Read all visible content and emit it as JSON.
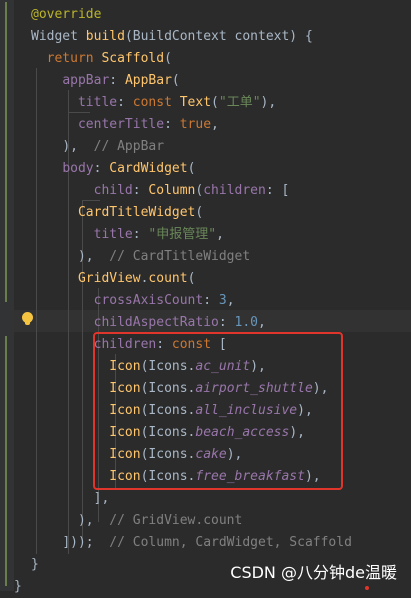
{
  "editor": {
    "lines": [
      {
        "segments": [
          {
            "t": "@override",
            "c": "ann"
          }
        ]
      },
      {
        "segments": [
          {
            "t": "Widget ",
            "c": ""
          },
          {
            "t": "build",
            "c": "fn"
          },
          {
            "t": "(BuildContext context) {",
            "c": ""
          }
        ]
      },
      {
        "segments": [
          {
            "t": "  ",
            "c": ""
          },
          {
            "t": "return ",
            "c": "kw"
          },
          {
            "t": "Scaffold",
            "c": "fn"
          },
          {
            "t": "(",
            "c": ""
          }
        ]
      },
      {
        "segments": [
          {
            "t": "    ",
            "c": ""
          },
          {
            "t": "appBar",
            "c": "param"
          },
          {
            "t": ": ",
            "c": ""
          },
          {
            "t": "AppBar",
            "c": "fn"
          },
          {
            "t": "(",
            "c": ""
          }
        ]
      },
      {
        "segments": [
          {
            "t": "      ",
            "c": ""
          },
          {
            "t": "title",
            "c": "param"
          },
          {
            "t": ": ",
            "c": ""
          },
          {
            "t": "const ",
            "c": "kw"
          },
          {
            "t": "Text",
            "c": "fn"
          },
          {
            "t": "(",
            "c": ""
          },
          {
            "t": "\"工单\"",
            "c": "str"
          },
          {
            "t": "),",
            "c": ""
          }
        ]
      },
      {
        "segments": [
          {
            "t": "      ",
            "c": ""
          },
          {
            "t": "centerTitle",
            "c": "param"
          },
          {
            "t": ": ",
            "c": ""
          },
          {
            "t": "true",
            "c": "kw"
          },
          {
            "t": ",",
            "c": ""
          }
        ]
      },
      {
        "segments": [
          {
            "t": "    ",
            "c": ""
          },
          {
            "t": "),  ",
            "c": ""
          },
          {
            "t": "// AppBar",
            "c": "cm"
          }
        ]
      },
      {
        "segments": [
          {
            "t": "    ",
            "c": ""
          },
          {
            "t": "body",
            "c": "param"
          },
          {
            "t": ": ",
            "c": ""
          },
          {
            "t": "CardWidget",
            "c": "fn"
          },
          {
            "t": "(",
            "c": ""
          }
        ]
      },
      {
        "segments": [
          {
            "t": "        ",
            "c": ""
          },
          {
            "t": "child",
            "c": "param"
          },
          {
            "t": ": ",
            "c": ""
          },
          {
            "t": "Column",
            "c": "fn"
          },
          {
            "t": "(",
            "c": ""
          },
          {
            "t": "children",
            "c": "param"
          },
          {
            "t": ": [",
            "c": ""
          }
        ]
      },
      {
        "segments": [
          {
            "t": "      ",
            "c": ""
          },
          {
            "t": "CardTitleWidget",
            "c": "fn"
          },
          {
            "t": "(",
            "c": ""
          }
        ]
      },
      {
        "segments": [
          {
            "t": "        ",
            "c": ""
          },
          {
            "t": "title",
            "c": "param"
          },
          {
            "t": ": ",
            "c": ""
          },
          {
            "t": "\"申报管理\"",
            "c": "str"
          },
          {
            "t": ",",
            "c": ""
          }
        ]
      },
      {
        "segments": [
          {
            "t": "      ",
            "c": ""
          },
          {
            "t": "),  ",
            "c": ""
          },
          {
            "t": "// CardTitleWidget",
            "c": "cm"
          }
        ]
      },
      {
        "segments": [
          {
            "t": "      ",
            "c": ""
          },
          {
            "t": "GridView",
            "c": "fn"
          },
          {
            "t": ".",
            "c": ""
          },
          {
            "t": "count",
            "c": "fn"
          },
          {
            "t": "(",
            "c": ""
          }
        ]
      },
      {
        "segments": [
          {
            "t": "        ",
            "c": ""
          },
          {
            "t": "crossAxisCount",
            "c": "param"
          },
          {
            "t": ": ",
            "c": ""
          },
          {
            "t": "3",
            "c": "num"
          },
          {
            "t": ",",
            "c": ""
          }
        ]
      },
      {
        "segments": [
          {
            "t": "        ",
            "c": ""
          },
          {
            "t": "childAspectRatio",
            "c": "param"
          },
          {
            "t": ": ",
            "c": ""
          },
          {
            "t": "1.0",
            "c": "num"
          },
          {
            "t": ",",
            "c": ""
          }
        ]
      },
      {
        "segments": [
          {
            "t": "        ",
            "c": ""
          },
          {
            "t": "children",
            "c": "param"
          },
          {
            "t": ": ",
            "c": ""
          },
          {
            "t": "const ",
            "c": "kw"
          },
          {
            "t": "[",
            "c": ""
          }
        ]
      },
      {
        "segments": [
          {
            "t": "          ",
            "c": ""
          },
          {
            "t": "Icon",
            "c": "fn"
          },
          {
            "t": "(Icons.",
            "c": ""
          },
          {
            "t": "ac_unit",
            "c": "it"
          },
          {
            "t": "),",
            "c": ""
          }
        ]
      },
      {
        "segments": [
          {
            "t": "          ",
            "c": ""
          },
          {
            "t": "Icon",
            "c": "fn"
          },
          {
            "t": "(Icons.",
            "c": ""
          },
          {
            "t": "airport_shuttle",
            "c": "it"
          },
          {
            "t": "),",
            "c": ""
          }
        ]
      },
      {
        "segments": [
          {
            "t": "          ",
            "c": ""
          },
          {
            "t": "Icon",
            "c": "fn"
          },
          {
            "t": "(Icons.",
            "c": ""
          },
          {
            "t": "all_inclusive",
            "c": "it"
          },
          {
            "t": "),",
            "c": ""
          }
        ]
      },
      {
        "segments": [
          {
            "t": "          ",
            "c": ""
          },
          {
            "t": "Icon",
            "c": "fn"
          },
          {
            "t": "(Icons.",
            "c": ""
          },
          {
            "t": "beach_access",
            "c": "it"
          },
          {
            "t": "),",
            "c": ""
          }
        ]
      },
      {
        "segments": [
          {
            "t": "          ",
            "c": ""
          },
          {
            "t": "Icon",
            "c": "fn"
          },
          {
            "t": "(Icons.",
            "c": ""
          },
          {
            "t": "cake",
            "c": "it"
          },
          {
            "t": "),",
            "c": ""
          }
        ]
      },
      {
        "segments": [
          {
            "t": "          ",
            "c": ""
          },
          {
            "t": "Icon",
            "c": "fn"
          },
          {
            "t": "(Icons.",
            "c": ""
          },
          {
            "t": "free_breakfast",
            "c": "it"
          },
          {
            "t": "),",
            "c": ""
          }
        ]
      },
      {
        "segments": [
          {
            "t": "        ",
            "c": ""
          },
          {
            "t": "],",
            "c": ""
          }
        ]
      },
      {
        "segments": [
          {
            "t": "      ",
            "c": ""
          },
          {
            "t": "),  ",
            "c": ""
          },
          {
            "t": "// GridView.count",
            "c": "cm"
          }
        ]
      },
      {
        "segments": [
          {
            "t": "    ",
            "c": ""
          },
          {
            "t": "]));  ",
            "c": ""
          },
          {
            "t": "// Column, CardWidget, Scaffold",
            "c": "cm"
          }
        ]
      },
      {
        "segments": [
          {
            "t": "}",
            "c": ""
          }
        ]
      },
      {
        "segments": [
          {
            "t": "}",
            "c": ""
          }
        ]
      }
    ],
    "highlighted_line": 14
  },
  "watermark": "CSDN @八分钟de温暖"
}
